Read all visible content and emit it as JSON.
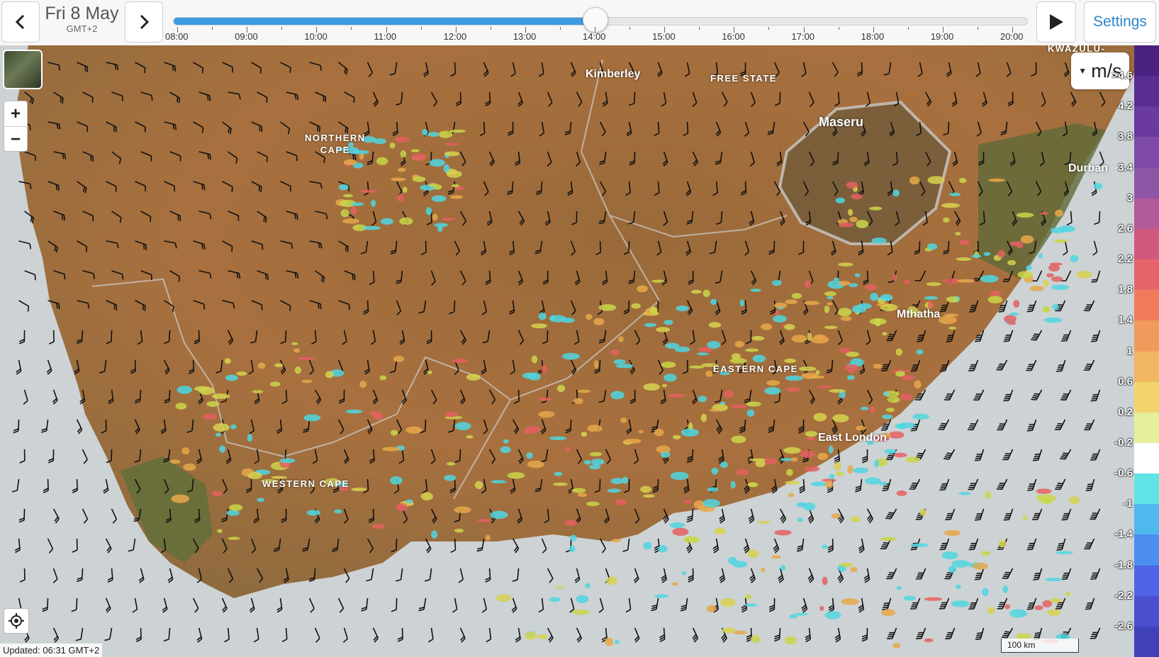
{
  "header": {
    "prev_icon": "chevron-left-icon",
    "next_icon": "chevron-right-icon",
    "date": "Fri 8 May",
    "timezone": "GMT+2",
    "play_icon": "play-icon",
    "settings_label": "Settings"
  },
  "timeline": {
    "labels": [
      "08:00",
      "09:00",
      "10:00",
      "11:00",
      "12:00",
      "13:00",
      "14:00",
      "15:00",
      "16:00",
      "17:00",
      "18:00",
      "19:00",
      "20:00"
    ],
    "current_index": 6,
    "progress": 0.5,
    "colors": {
      "fill": "#3d9be0"
    }
  },
  "map": {
    "provinces": [
      {
        "name": "NORTHERN\nCAPE"
      },
      {
        "name": "FREE STATE"
      },
      {
        "name": "EASTERN CAPE"
      },
      {
        "name": "WESTERN CAPE"
      },
      {
        "name": "KWAZULU-\nN"
      }
    ],
    "cities": [
      "Kimberley",
      "Maseru",
      "Durban",
      "Mthatha",
      "East London"
    ],
    "layer_icon": "satellite-layer-icon",
    "zoom_in_label": "+",
    "zoom_out_label": "−",
    "locate_icon": "locate-icon",
    "updated": "Updated: 06:31 GMT+2",
    "scale": "100 km"
  },
  "legend": {
    "unit": "m/s",
    "unit_caret_icon": "caret-down-icon",
    "labels": [
      ">4.6",
      "4.2",
      "3.8",
      "3.4",
      "3",
      "2.6",
      "2.2",
      "1.8",
      "1.4",
      "1",
      "0.6",
      "0.2",
      "-0.2",
      "-0.6",
      "-1",
      "-1.4",
      "-1.8",
      "-2.2",
      "-2.6"
    ],
    "colors": [
      "#4a2382",
      "#5a2d92",
      "#6a3a9e",
      "#7d4aa8",
      "#8f56a6",
      "#b25a98",
      "#cf5a7e",
      "#e6656a",
      "#ef7b5c",
      "#f09a5c",
      "#f1b660",
      "#f3d46c",
      "#e6ee9a",
      "#ffffff",
      "#5fe3e6",
      "#4fb8ee",
      "#4b8ef0",
      "#4e63e6",
      "#4a4fcf",
      "#4040b8"
    ]
  }
}
